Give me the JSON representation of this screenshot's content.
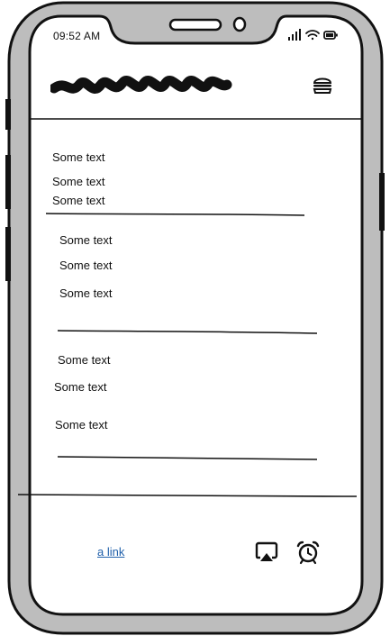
{
  "status_bar": {
    "time": "09:52 AM"
  },
  "header": {
    "logo_icon": "scribble-logo-icon",
    "menu_icon": "hamburger-menu-icon"
  },
  "content": {
    "group1": [
      "Some text",
      "Some text",
      "Some text"
    ],
    "group2": [
      "Some text",
      "Some text",
      "Some text"
    ],
    "group3": [
      "Some text",
      "Some text",
      "Some text"
    ]
  },
  "footer": {
    "link_label": "a link",
    "icons": [
      "airplay-icon",
      "alarm-clock-icon"
    ]
  },
  "colors": {
    "frame_gray": "#bdbdbd",
    "ink": "#111111",
    "link": "#1f5faa"
  }
}
